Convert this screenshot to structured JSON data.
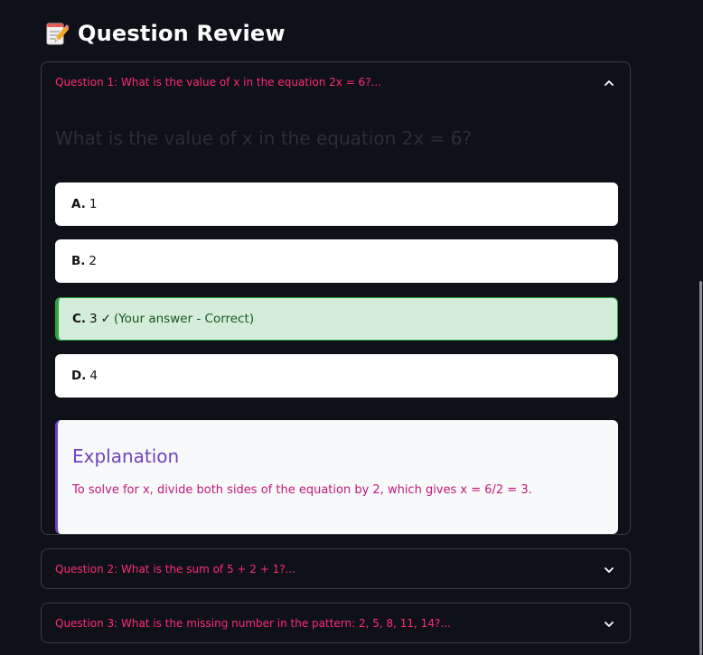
{
  "page": {
    "title": "Question Review",
    "title_icon": "memo-icon"
  },
  "colors": {
    "background": "#0e1117",
    "summary_text": "#ff2b74",
    "correct_bg": "#d4edda",
    "correct_border": "#28a745",
    "explanation_accent": "#6f42c1",
    "explanation_text": "#c0187a"
  },
  "questions": [
    {
      "summary": "Question 1: What is the value of x in the equation 2x = 6?...",
      "expanded": true,
      "question": "What is the value of x in the equation 2x = 6?",
      "options": [
        {
          "letter": "A.",
          "text": "1"
        },
        {
          "letter": "B.",
          "text": "2"
        },
        {
          "letter": "C.",
          "text": "3",
          "check": "✓",
          "verdict": "(Your answer - Correct)"
        },
        {
          "letter": "D.",
          "text": "4"
        }
      ],
      "explanation": {
        "title": "Explanation",
        "text": "To solve for x, divide both sides of the equation by 2, which gives x = 6/2 = 3."
      }
    },
    {
      "summary": "Question 2: What is the sum of 5 + 2 + 1?...",
      "expanded": false
    },
    {
      "summary": "Question 3: What is the missing number in the pattern: 2, 5, 8, 11, 14?...",
      "expanded": false
    }
  ]
}
